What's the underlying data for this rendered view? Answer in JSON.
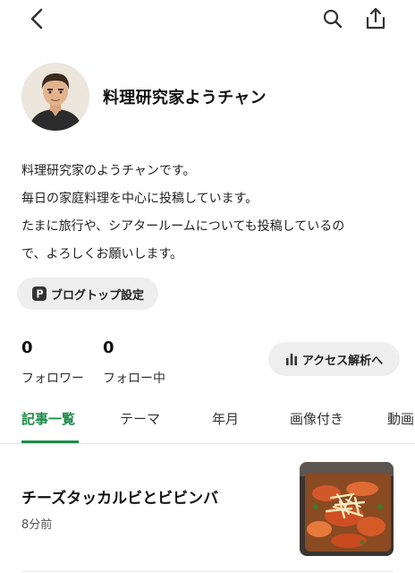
{
  "toolbar": {
    "back_icon": "chevron-left-icon",
    "search_icon": "search-icon",
    "share_icon": "share-icon"
  },
  "profile": {
    "name": "料理研究家ようチャン"
  },
  "bio": {
    "lines": [
      "料理研究家のようチャンです。",
      "毎日の家庭料理を中心に投稿しています。",
      "たまに旅行や、シアタールームについても投稿しているの",
      "で、よろしくお願いします。"
    ]
  },
  "blog_top_button": {
    "label": "ブログトップ設定",
    "icon": "blog-p-icon"
  },
  "stats": {
    "followers_count": "0",
    "followers_label": "フォロワー",
    "following_count": "0",
    "following_label": "フォロー中"
  },
  "access_button": {
    "label": "アクセス解析へ",
    "icon": "bar-chart-icon"
  },
  "tabs": [
    {
      "label": "記事一覧",
      "active": true
    },
    {
      "label": "テーマ",
      "active": false
    },
    {
      "label": "年月",
      "active": false
    },
    {
      "label": "画像付き",
      "active": false
    },
    {
      "label": "動画",
      "active": false
    }
  ],
  "articles": [
    {
      "title": "チーズタッカルビとビビンバ",
      "time": "8分前"
    }
  ],
  "colors": {
    "accent": "#1f8a4a",
    "pill_bg": "#eeeeee",
    "divider": "#e6e6e6"
  }
}
